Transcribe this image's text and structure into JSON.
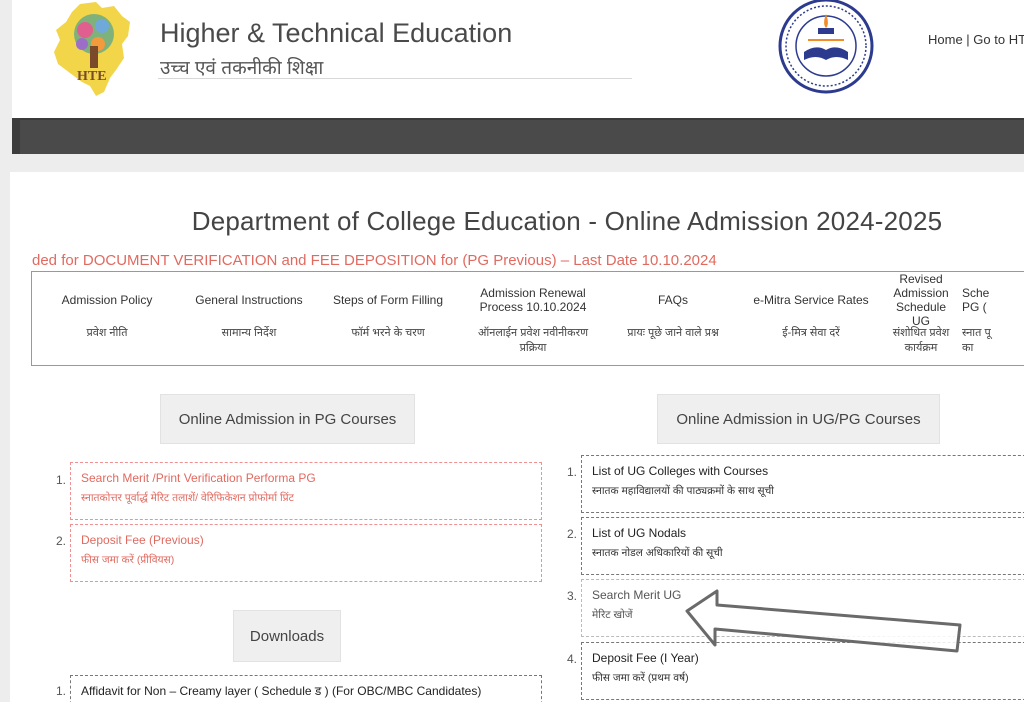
{
  "header": {
    "title": "Higher & Technical Education",
    "subtitle": "उच्च एवं तकनीकी शिक्षा",
    "logo_text": "HTE",
    "toplinks": {
      "home": "Home",
      "separator": " | ",
      "go_to_hte": "Go to HTE"
    }
  },
  "main": {
    "title": "Department of College Education - Online Admission 2024-2025",
    "ticker": "ded for DOCUMENT VERIFICATION and FEE DEPOSITION for (PG Previous) – Last Date 10.10.2024",
    "quick_links": [
      {
        "en": "Admission Policy",
        "hi": "प्रवेश नीति"
      },
      {
        "en": "General Instructions",
        "hi": "सामान्य निर्देश"
      },
      {
        "en": "Steps of Form Filling",
        "hi": "फॉर्म भरने के चरण"
      },
      {
        "en": "Admission Renewal Process 10.10.2024",
        "hi": "ऑनलाईन प्रवेश नवीनीकरण प्रक्रिया"
      },
      {
        "en": "FAQs",
        "hi": "प्रायः पूछे जाने वाले प्रश्न"
      },
      {
        "en": "e-Mitra Service Rates",
        "hi": "ई-मित्र सेवा दरें"
      },
      {
        "en": "Revised Admission Schedule UG",
        "hi": "संशोधित प्रवेश कार्यक्रम"
      },
      {
        "en": "Sche PG (",
        "hi": "स्नात पू का"
      }
    ],
    "pg_section": {
      "heading": "Online Admission in PG Courses",
      "items": [
        {
          "num": "1.",
          "en": "Search Merit /Print Verification Performa PG",
          "hi": "स्नातकोत्तर पूर्वार्द्ध मेरिट तलाशें/ वेरिफिकेशन प्रोफोर्मा प्रिंट"
        },
        {
          "num": "2.",
          "en": "Deposit Fee (Previous)",
          "hi": "फीस जमा करें (प्रीवियस)"
        }
      ]
    },
    "downloads": {
      "heading": "Downloads",
      "items": [
        {
          "num": "1.",
          "en": "Affidavit for Non – Creamy layer ( Schedule ड ) (For OBC/MBC Candidates)"
        }
      ]
    },
    "ug_section": {
      "heading": "Online Admission in UG/PG Courses",
      "items": [
        {
          "num": "1.",
          "en": "List of UG Colleges with Courses",
          "hi": "स्नातक महाविद्यालयों की पाठ्यक्रमों के साथ सूची"
        },
        {
          "num": "2.",
          "en": "List of UG Nodals",
          "hi": "स्नातक नोडल अधिकारियों की सूची"
        },
        {
          "num": "3.",
          "en": "Search Merit UG",
          "hi": "मेरिट खोजें"
        },
        {
          "num": "4.",
          "en": "Deposit Fee (I Year)",
          "hi": "फीस जमा करें (प्रथम वर्ष)"
        }
      ]
    }
  },
  "colors": {
    "accent_red": "#e06a60",
    "navbar": "#4a4a4a",
    "dashed_pink": "#f09090"
  }
}
